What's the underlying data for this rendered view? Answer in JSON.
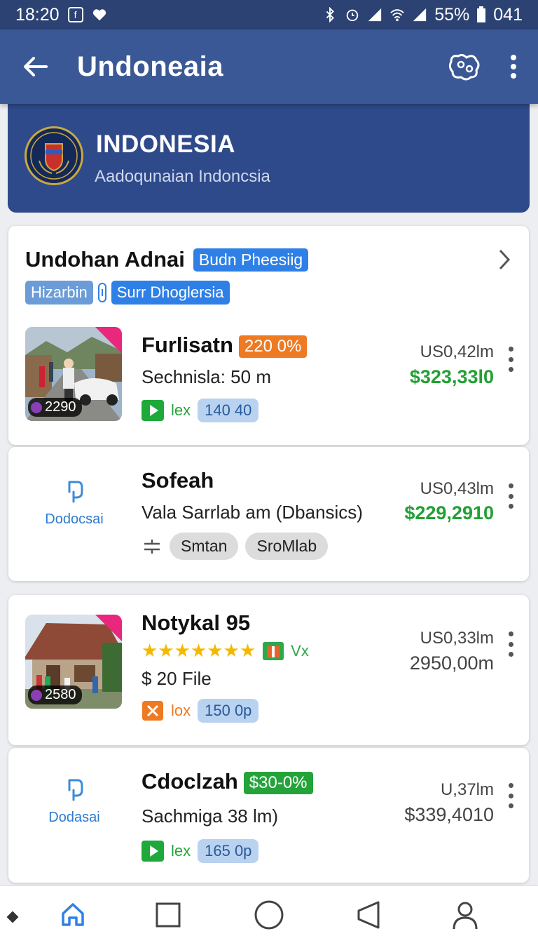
{
  "status_bar": {
    "time": "18:20",
    "battery": "55%",
    "extra": "041"
  },
  "app_bar": {
    "title": "Undoneaia"
  },
  "banner": {
    "title": "INDONESIA",
    "subtitle": "Aadoqunaian Indoncsia"
  },
  "group": {
    "title": "Undohan Adnai",
    "badge": "Budn Pheesiig",
    "tag_1": "Hizarbin",
    "tag_2": "Surr Dhoglersia"
  },
  "listings": [
    {
      "title": "Furlisatn",
      "badge": "220 0%",
      "subtitle": "Sechnisla: 50 m",
      "price_top": "US0,42lm",
      "price_main": "$323,33l0",
      "photo_count": "2290",
      "meta_label": "lex",
      "meta_chip": "140 40"
    },
    {
      "title": "Sofeah",
      "placeholder_label": "Dodocsai",
      "subtitle": "Vala Sarrlab am (Dbansics)",
      "price_top": "US0,43lm",
      "price_main": "$229,2910",
      "chip_1": "Smtan",
      "chip_2": "SroMlab"
    },
    {
      "title": "Notykal 95",
      "stars": "★★★★★★★",
      "rating_label": "Vx",
      "subtitle": "$ 20 File",
      "price_top": "US0,33lm",
      "price_main": "2950,00m",
      "photo_count": "2580",
      "meta_label": "lox",
      "meta_chip": "150 0p"
    },
    {
      "title": "Cdoclzah",
      "badge": "$30-0%",
      "placeholder_label": "Dodasai",
      "subtitle": "Sachmiga 38 lm)",
      "price_top": "U,37lm",
      "price_main": "$339,4010",
      "meta_label": "lex",
      "meta_chip": "165 0p"
    }
  ],
  "colors": {
    "app_bar": "#3b5896",
    "banner": "#2e4a8a",
    "price_green": "#22a033",
    "accent_blue": "#2f80e6"
  }
}
